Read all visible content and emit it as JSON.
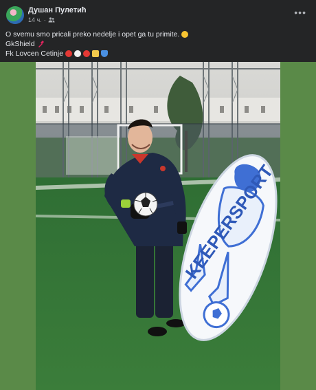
{
  "post": {
    "author": "Душан Пулетић",
    "time": "14 ч.",
    "privacy_icon": "friends-icon",
    "more_icon": "more-dots-icon",
    "lines": {
      "line1": "O svemu smo pricali preko nedelje i opet ga tu primite.",
      "line2": "GkShield",
      "line3": "Fk Lovcen Cetinje"
    },
    "emoji": {
      "wink": "😉",
      "glove": "🧤"
    },
    "image": {
      "alt_icon": "photo",
      "mannequin_text": "KEEPERSPORT"
    }
  },
  "colors": {
    "background": "#242526",
    "text": "#e4e6eb",
    "muted": "#b0b3b8",
    "pitch": "#4f8a3c"
  }
}
